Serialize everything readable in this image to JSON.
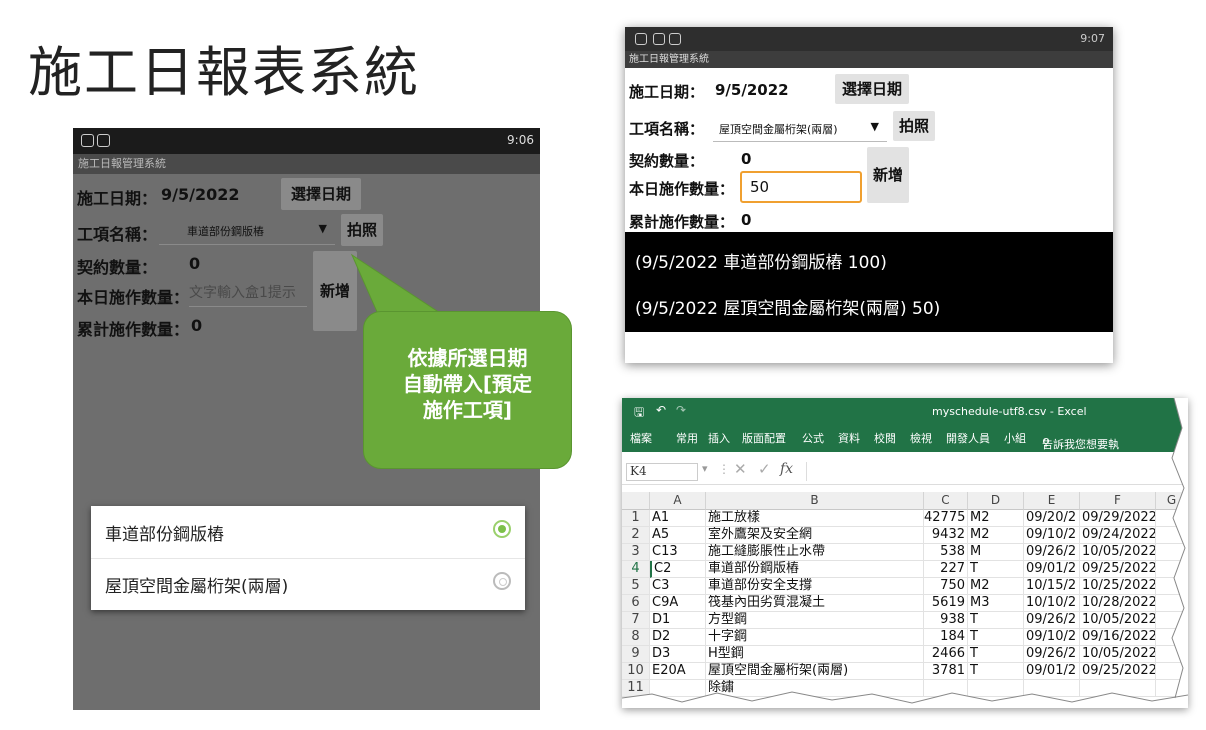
{
  "slide_title": "施工日報表系統",
  "phone1": {
    "status_time": "9:06",
    "app_title": "施工日報管理系統",
    "date_label": "施工日期：",
    "date_value": "9/5/2022",
    "choose_date_button": "選擇日期",
    "item_label": "工項名稱：",
    "item_value": "車道部份鋼版樁",
    "photo_button": "拍照",
    "contract_label": "契約數量：",
    "contract_value": "0",
    "today_label": "本日施作數量：",
    "today_placeholder": "文字輸入盒1提示",
    "add_button": "新增",
    "total_label": "累計施作數量：",
    "total_value": "0",
    "dialog_options": [
      {
        "label": "車道部份鋼版樁",
        "selected": true
      },
      {
        "label": "屋頂空間金屬桁架(兩層)",
        "selected": false
      }
    ]
  },
  "callout": {
    "lines": [
      "依據所選日期",
      "自動帶入[預定",
      "施作工項]"
    ],
    "color": "#6aaa3a"
  },
  "phone2": {
    "status_time": "9:07",
    "app_title": "施工日報管理系統",
    "date_label": "施工日期：",
    "date_value": "9/5/2022",
    "choose_date_button": "選擇日期",
    "item_label": "工項名稱：",
    "item_value": "屋頂空間金屬桁架(兩層)",
    "photo_button": "拍照",
    "contract_label": "契約數量：",
    "contract_value": "0",
    "today_label": "本日施作數量：",
    "today_value": "50",
    "add_button": "新增",
    "total_label": "累計施作數量：",
    "total_value": "0",
    "records": [
      "(9/5/2022 車道部份鋼版樁 100)",
      "(9/5/2022 屋頂空間金屬桁架(兩層) 50)"
    ]
  },
  "excel": {
    "window_title": "myschedule-utf8.csv - Excel",
    "ribbon_tabs": [
      "檔案",
      "常用",
      "插入",
      "版面配置",
      "公式",
      "資料",
      "校閱",
      "檢視",
      "開發人員",
      "小組",
      "告訴我您想要執"
    ],
    "name_box": "K4",
    "formula_fx": "fx",
    "columns": [
      "A",
      "B",
      "C",
      "D",
      "E",
      "F",
      "G"
    ],
    "rows": [
      [
        "1",
        "A1",
        "施工放樣",
        "42775",
        "M2",
        "09/20/2",
        "09/29/2022"
      ],
      [
        "2",
        "A5",
        "室外鷹架及安全網",
        "9432",
        "M2",
        "09/10/2",
        "09/24/2022"
      ],
      [
        "3",
        "C13",
        "施工縫膨脹性止水帶",
        "538",
        "M",
        "09/26/2",
        "10/05/2022"
      ],
      [
        "4",
        "C2",
        "車道部份鋼版樁",
        "227",
        "T",
        "09/01/2",
        "09/25/2022"
      ],
      [
        "5",
        "C3",
        "車道部份安全支撐",
        "750",
        "M2",
        "10/15/2",
        "10/25/2022"
      ],
      [
        "6",
        "C9A",
        "筏基內田劣質混凝土",
        "5619",
        "M3",
        "10/10/2",
        "10/28/2022"
      ],
      [
        "7",
        "D1",
        "方型鋼",
        "938",
        "T",
        "09/26/2",
        "10/05/2022"
      ],
      [
        "8",
        "D2",
        "十字鋼",
        "184",
        "T",
        "09/10/2",
        "09/16/2022"
      ],
      [
        "9",
        "D3",
        "H型鋼",
        "2466",
        "T",
        "09/26/2",
        "10/05/2022"
      ],
      [
        "10",
        "E20A",
        "屋頂空間金屬桁架(兩層)",
        "3781",
        "T",
        "09/01/2",
        "09/25/2022"
      ],
      [
        "11",
        "",
        "除鏽",
        "",
        "",
        "",
        ""
      ]
    ]
  }
}
